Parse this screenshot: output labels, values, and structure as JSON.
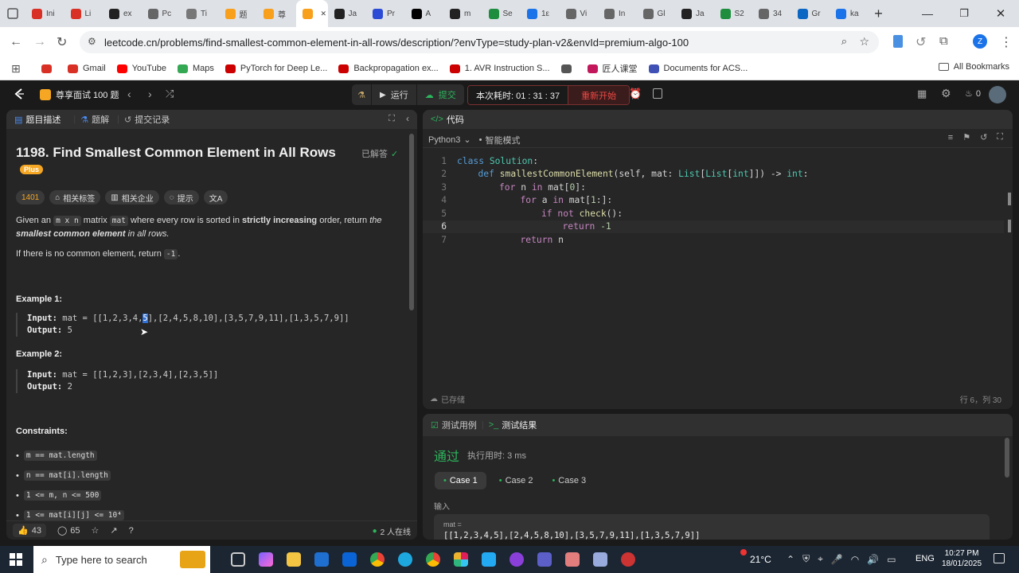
{
  "browser": {
    "tabs": [
      {
        "label": "Ini",
        "color": "#d93025"
      },
      {
        "label": "Li",
        "color": "#d93025"
      },
      {
        "label": "ex",
        "color": "#222"
      },
      {
        "label": "Pc",
        "color": "#666"
      },
      {
        "label": "Ti",
        "color": "#777"
      },
      {
        "label": "题",
        "color": "#f89f1b"
      },
      {
        "label": "尊",
        "color": "#f89f1b"
      },
      {
        "label": "",
        "color": "#f89f1b"
      },
      {
        "label": "Ja",
        "color": "#222"
      },
      {
        "label": "Pr",
        "color": "#2b4bd6"
      },
      {
        "label": "A",
        "color": "#000"
      },
      {
        "label": "m",
        "color": "#222"
      },
      {
        "label": "Se",
        "color": "#1e8e3e"
      },
      {
        "label": "1ε",
        "color": "#1a73e8"
      },
      {
        "label": "Vi",
        "color": "#666"
      },
      {
        "label": "In",
        "color": "#666"
      },
      {
        "label": "Gl",
        "color": "#666"
      },
      {
        "label": "Ja",
        "color": "#222"
      },
      {
        "label": "S2",
        "color": "#1e8e3e"
      },
      {
        "label": "34",
        "color": "#666"
      },
      {
        "label": "Gr",
        "color": "#0a66c2"
      },
      {
        "label": "ka",
        "color": "#1a73e8"
      }
    ],
    "url": "leetcode.cn/problems/find-smallest-common-element-in-all-rows/description/?envType=study-plan-v2&envId=premium-algo-100",
    "profile_initial": "Z",
    "bookmarks": [
      {
        "label": "",
        "color": "#d93025"
      },
      {
        "label": "Gmail",
        "color": "#d93025"
      },
      {
        "label": "YouTube",
        "color": "#ff0000"
      },
      {
        "label": "Maps",
        "color": "#34a853"
      },
      {
        "label": "PyTorch for Deep Le...",
        "color": "#cc0000"
      },
      {
        "label": "Backpropagation ex...",
        "color": "#cc0000"
      },
      {
        "label": "1. AVR Instruction S...",
        "color": "#cc0000"
      },
      {
        "label": "",
        "color": "#555"
      },
      {
        "label": "匠人课堂",
        "color": "#c2185b"
      },
      {
        "label": "Documents for ACS...",
        "color": "#3f51b5"
      }
    ],
    "all_bookmarks": "All Bookmarks"
  },
  "lc": {
    "study_plan": "尊享面试 100 题",
    "run": "运行",
    "submit": "提交",
    "timer": "本次耗时: 01 : 31 : 37",
    "restart": "重新开始",
    "streak": "0"
  },
  "left": {
    "tabs": [
      "题目描述",
      "题解",
      "提交记录"
    ],
    "title": "1198. Find Smallest Common Element in All Rows",
    "solved": "已解答",
    "plus": "Plus",
    "difficulty": "1401",
    "pills": [
      "相关标签",
      "相关企业",
      "提示",
      "文A"
    ],
    "desc": {
      "a": "Given an ",
      "m_x_n": "m x n",
      "b": " matrix ",
      "mat": "mat",
      "c": " where every row is sorted in ",
      "strict": "strictly increasing",
      "d": " order, return ",
      "the": "the ",
      "smallest": "smallest common element",
      "e": " in all rows."
    },
    "nocommon": "If there is no common element, return ",
    "neg1": "-1",
    "dot": ".",
    "ex1_title": "Example 1:",
    "ex1_input_label": "Input:",
    "ex1_input_pre": " mat = [[1,2,3,4,",
    "ex1_input_sel": "5",
    "ex1_input_post": "],[2,4,5,8,10],[3,5,7,9,11],[1,3,5,7,9]]",
    "ex1_output_label": "Output:",
    "ex1_output": " 5",
    "ex2_title": "Example 2:",
    "ex2_input_label": "Input:",
    "ex2_input": " mat = [[1,2,3],[2,3,4],[2,3,5]]",
    "ex2_output_label": "Output:",
    "ex2_output": " 2",
    "constraints_title": "Constraints:",
    "constraints": [
      "m == mat.length",
      "n == mat[i].length",
      "1 <= m, n <= 500",
      "1 <= mat[i][j] <= 10⁴"
    ],
    "likes": "43",
    "comments": "65",
    "online": "2 人在线"
  },
  "code": {
    "tab": "代码",
    "lang": "Python3",
    "mode": "智能模式",
    "saved": "已存储",
    "position": "行 6，列 30",
    "lines": [
      {
        "n": "1",
        "indent": 0,
        "tokens": [
          {
            "t": "class ",
            "c": "kw"
          },
          {
            "t": "Solution",
            "c": "cls"
          },
          {
            "t": ":",
            "c": ""
          }
        ]
      },
      {
        "n": "2",
        "indent": 1,
        "tokens": [
          {
            "t": "def ",
            "c": "kw"
          },
          {
            "t": "smallestCommonElement",
            "c": "fn"
          },
          {
            "t": "(self, mat: ",
            "c": ""
          },
          {
            "t": "List",
            "c": "ty"
          },
          {
            "t": "[",
            "c": ""
          },
          {
            "t": "List",
            "c": "ty"
          },
          {
            "t": "[",
            "c": ""
          },
          {
            "t": "int",
            "c": "ty"
          },
          {
            "t": "]]) -> ",
            "c": ""
          },
          {
            "t": "int",
            "c": "ty"
          },
          {
            "t": ":",
            "c": ""
          }
        ]
      },
      {
        "n": "3",
        "indent": 2,
        "tokens": [
          {
            "t": "for ",
            "c": "ctl"
          },
          {
            "t": "n ",
            "c": ""
          },
          {
            "t": "in ",
            "c": "ctl"
          },
          {
            "t": "mat[",
            "c": ""
          },
          {
            "t": "0",
            "c": "num"
          },
          {
            "t": "]:",
            "c": ""
          }
        ]
      },
      {
        "n": "4",
        "indent": 3,
        "tokens": [
          {
            "t": "for ",
            "c": "ctl"
          },
          {
            "t": "a ",
            "c": ""
          },
          {
            "t": "in ",
            "c": "ctl"
          },
          {
            "t": "mat[",
            "c": ""
          },
          {
            "t": "1",
            "c": "num"
          },
          {
            "t": ":]:",
            "c": ""
          }
        ]
      },
      {
        "n": "5",
        "indent": 4,
        "tokens": [
          {
            "t": "if not ",
            "c": "ctl"
          },
          {
            "t": "check",
            "c": "fn"
          },
          {
            "t": "():",
            "c": ""
          }
        ]
      },
      {
        "n": "6",
        "indent": 5,
        "tokens": [
          {
            "t": "return ",
            "c": "ctl"
          },
          {
            "t": "-1",
            "c": "num"
          }
        ]
      },
      {
        "n": "7",
        "indent": 3,
        "tokens": [
          {
            "t": "return ",
            "c": "ctl"
          },
          {
            "t": "n",
            "c": ""
          }
        ]
      }
    ]
  },
  "result": {
    "tabs": [
      "测试用例",
      "测试结果"
    ],
    "status": "通过",
    "runtime": "执行用时: 3 ms",
    "cases": [
      "Case 1",
      "Case 2",
      "Case 3"
    ],
    "input_label": "输入",
    "var": "mat =",
    "value": "[[1,2,3,4,5],[2,4,5,8,10],[3,5,7,9,11],[1,3,5,7,9]]"
  },
  "taskbar": {
    "search_placeholder": "Type here to search",
    "temp": "21°C",
    "lang": "ENG",
    "time": "10:27 PM",
    "date": "18/01/2025"
  }
}
